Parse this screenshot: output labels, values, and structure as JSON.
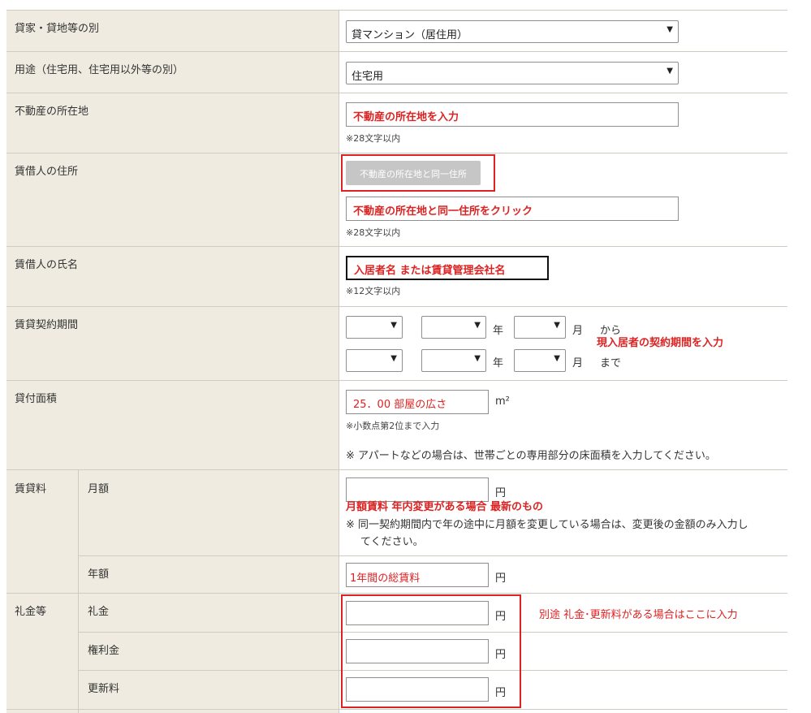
{
  "rows": {
    "type": {
      "label": "貸家・貸地等の別",
      "value": "貸マンション（居住用）"
    },
    "usage": {
      "label": "用途（住宅用、住宅用以外等の別）",
      "value": "住宅用"
    },
    "location": {
      "label": "不動産の所在地",
      "value": "不動産の所在地を入力",
      "note": "※28文字以内"
    },
    "tenant_address": {
      "label": "賃借人の住所",
      "button": "不動産の所在地と同一住所",
      "value": "不動産の所在地と同一住所をクリック",
      "note": "※28文字以内"
    },
    "tenant_name": {
      "label": "賃借人の氏名",
      "value": "入居者名 または賃貸管理会社名",
      "note": "※12文字以内"
    },
    "period": {
      "label": "賃貸契約期間",
      "year": "年",
      "month": "月",
      "from": "から",
      "to": "まで",
      "annotation": "現入居者の契約期間を入力"
    },
    "area": {
      "label": "貸付面積",
      "value": "25．00 部屋の広さ",
      "unit": "m²",
      "note1": "※小数点第2位まで入力",
      "note2": "※ アパートなどの場合は、世帯ごとの専用部分の床面積を入力してください。"
    },
    "rent": {
      "label": "賃貸料",
      "monthly_label": "月額",
      "yen": "円",
      "annotation": "月額賃料 年内変更がある場合 最新のもの",
      "note_line1": "※ 同一契約期間内で年の途中に月額を変更している場合は、変更後の金額のみ入力し",
      "note_line2": "てください。",
      "yearly_label": "年額",
      "yearly_value": "1年間の総賃料"
    },
    "deposit": {
      "label": "礼金等",
      "key_money": "礼金",
      "premium": "権利金",
      "renewal": "更新料",
      "yen": "円",
      "annotation": "別途 礼金･更新料がある場合はここに入力"
    }
  }
}
